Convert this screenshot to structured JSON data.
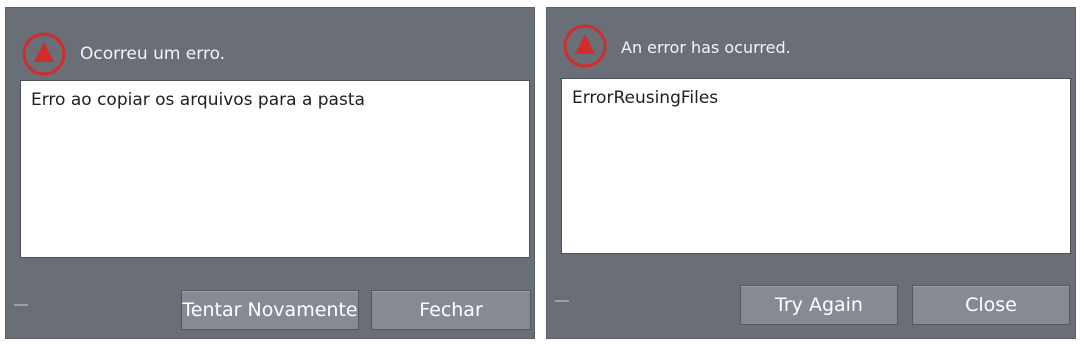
{
  "colors": {
    "dialog_bg": "#6a6f77",
    "button_bg": "#868b93",
    "warning_red": "#d22b2b",
    "message_bg": "#ffffff"
  },
  "dialogs": [
    {
      "language": "pt",
      "icon": "warning-triangle-icon",
      "title": "Ocorreu um erro.",
      "message": "Erro ao copiar os arquivos para a pasta",
      "minimize_label": "",
      "buttons": [
        {
          "label": "Tentar Novamente"
        },
        {
          "label": "Fechar"
        }
      ]
    },
    {
      "language": "en",
      "icon": "warning-triangle-icon",
      "title": "An error has ocurred.",
      "message": "ErrorReusingFiles",
      "minimize_label": "",
      "buttons": [
        {
          "label": "Try Again"
        },
        {
          "label": "Close"
        }
      ]
    }
  ]
}
